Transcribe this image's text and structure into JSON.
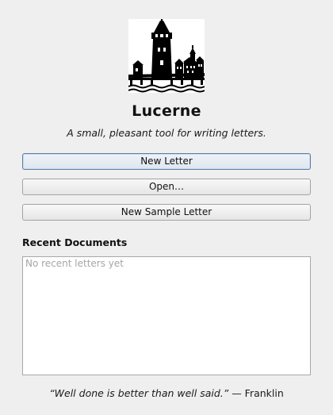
{
  "app": {
    "title": "Lucerne",
    "tagline": "A small, pleasant tool for writing letters.",
    "logo_icon": "lucerne-chapel-bridge-tower-logo"
  },
  "actions": {
    "new_letter": "New Letter",
    "open": "Open…",
    "new_sample_letter": "New Sample Letter"
  },
  "recent": {
    "heading": "Recent Documents",
    "items": [],
    "empty_message": "No recent letters yet"
  },
  "footer": {
    "quote_text": "“Well done is better than well said.”",
    "quote_attribution": " — Franklin"
  },
  "colors": {
    "window_background": "#efefef",
    "default_button_border": "#5a7fa8",
    "placeholder_text": "#a6a6a6"
  }
}
